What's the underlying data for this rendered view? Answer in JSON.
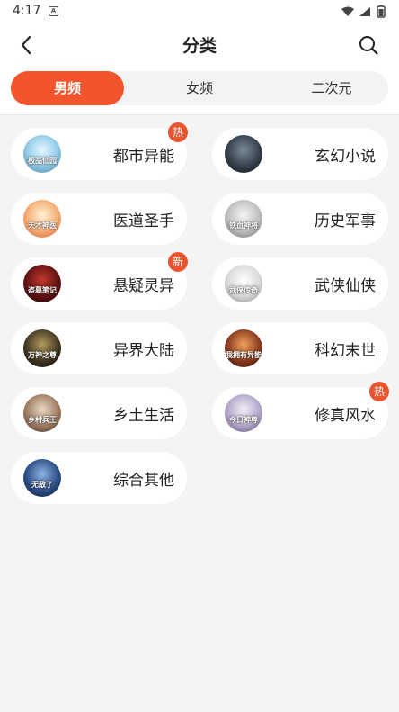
{
  "status": {
    "time": "4:17",
    "notification_glyph": "A"
  },
  "header": {
    "title": "分类"
  },
  "tabs": [
    {
      "label": "男频",
      "active": true
    },
    {
      "label": "女频",
      "active": false
    },
    {
      "label": "二次元",
      "active": false
    }
  ],
  "categories": [
    {
      "name": "都市异能",
      "badge": "热",
      "cover_text": "极品仙园"
    },
    {
      "name": "玄幻小说",
      "badge": "",
      "cover_text": ""
    },
    {
      "name": "医道圣手",
      "badge": "",
      "cover_text": "天才神医"
    },
    {
      "name": "历史军事",
      "badge": "",
      "cover_text": "铁血神将"
    },
    {
      "name": "悬疑灵异",
      "badge": "新",
      "cover_text": "盗墓笔记"
    },
    {
      "name": "武侠仙侠",
      "badge": "",
      "cover_text": "武侠传奇"
    },
    {
      "name": "异界大陆",
      "badge": "",
      "cover_text": "万神之尊"
    },
    {
      "name": "科幻末世",
      "badge": "",
      "cover_text": "我拥有异能"
    },
    {
      "name": "乡土生活",
      "badge": "",
      "cover_text": "乡村兵王"
    },
    {
      "name": "修真风水",
      "badge": "热",
      "cover_text": "今日神尊"
    },
    {
      "name": "综合其他",
      "badge": "",
      "cover_text": "无敌了"
    }
  ],
  "colors": {
    "accent": "#f2552c",
    "badge": "#e9542e",
    "background": "#f3f4f6"
  }
}
